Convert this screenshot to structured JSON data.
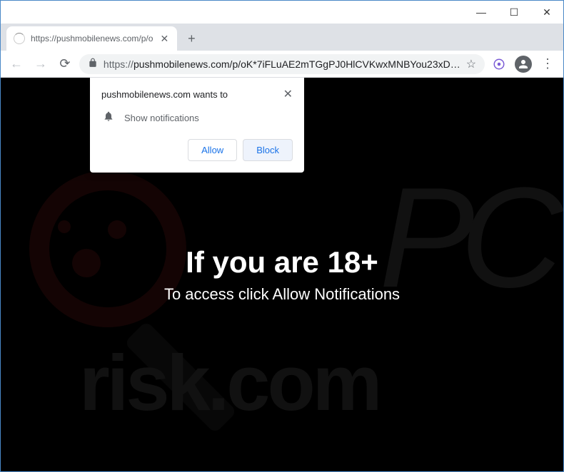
{
  "window": {
    "minimize": "—",
    "maximize": "☐",
    "close": "✕"
  },
  "tab": {
    "title": "https://pushmobilenews.com/p/o",
    "close": "✕"
  },
  "toolbar": {
    "url_proto": "https://",
    "url_rest": "pushmobilenews.com/p/oK*7iFLuAE2mTGgPJ0HlCVKwxMNBYou23xD…"
  },
  "dialog": {
    "title": "pushmobilenews.com wants to",
    "permission": "Show notifications",
    "allow": "Allow",
    "block": "Block",
    "close": "✕"
  },
  "page": {
    "headline": "If you are 18+",
    "subline": "To access click Allow Notifications"
  },
  "watermark": {
    "pc": "PC",
    "risk": "risk.com"
  }
}
